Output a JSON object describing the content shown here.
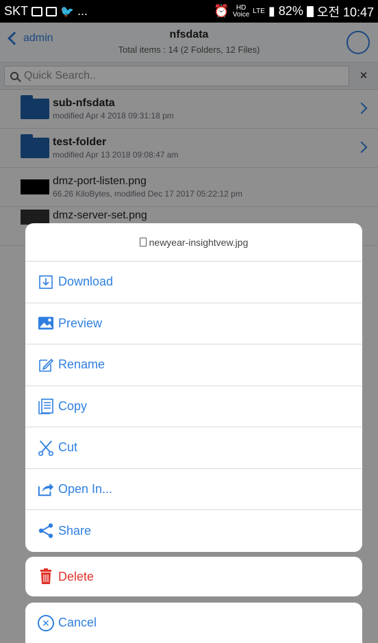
{
  "status_bar": {
    "carrier": "SKT",
    "more": "...",
    "hd_label": "HD",
    "voice_label": "Voice",
    "lte_label": "LTE",
    "battery": "82%",
    "time": "오전 10:47"
  },
  "header": {
    "back_label": "admin",
    "title": "nfsdata",
    "subtitle": "Total items : 14 (2 Folders, 12 Files)"
  },
  "search": {
    "placeholder": "Quick Search..",
    "clear_label": "×"
  },
  "files": [
    {
      "name": "sub-nfsdata",
      "meta": "modified Apr 4 2018 09:31:18 pm",
      "type": "folder"
    },
    {
      "name": "test-folder",
      "meta": "modified Apr 13 2018 09:08:47 am",
      "type": "folder"
    },
    {
      "name": "dmz-port-listen.png",
      "meta": "66.26 KiloBytes, modified Dec 17 2017 05:22:12 pm",
      "type": "image"
    }
  ],
  "partial_row_text": "dmz-server-set.png",
  "action_sheet": {
    "file_name": "newyear-insightvew.jpg",
    "actions": [
      {
        "label": "Download",
        "icon": "download-icon"
      },
      {
        "label": "Preview",
        "icon": "image-icon"
      },
      {
        "label": "Rename",
        "icon": "edit-icon"
      },
      {
        "label": "Copy",
        "icon": "copy-icon"
      },
      {
        "label": "Cut",
        "icon": "scissors-icon"
      },
      {
        "label": "Open In...",
        "icon": "share-out-icon"
      },
      {
        "label": "Share",
        "icon": "share-icon"
      }
    ],
    "delete_label": "Delete",
    "cancel_label": "Cancel"
  },
  "colors": {
    "accent": "#2f7fe0",
    "danger": "#e0322a",
    "folder": "#2060a8"
  }
}
